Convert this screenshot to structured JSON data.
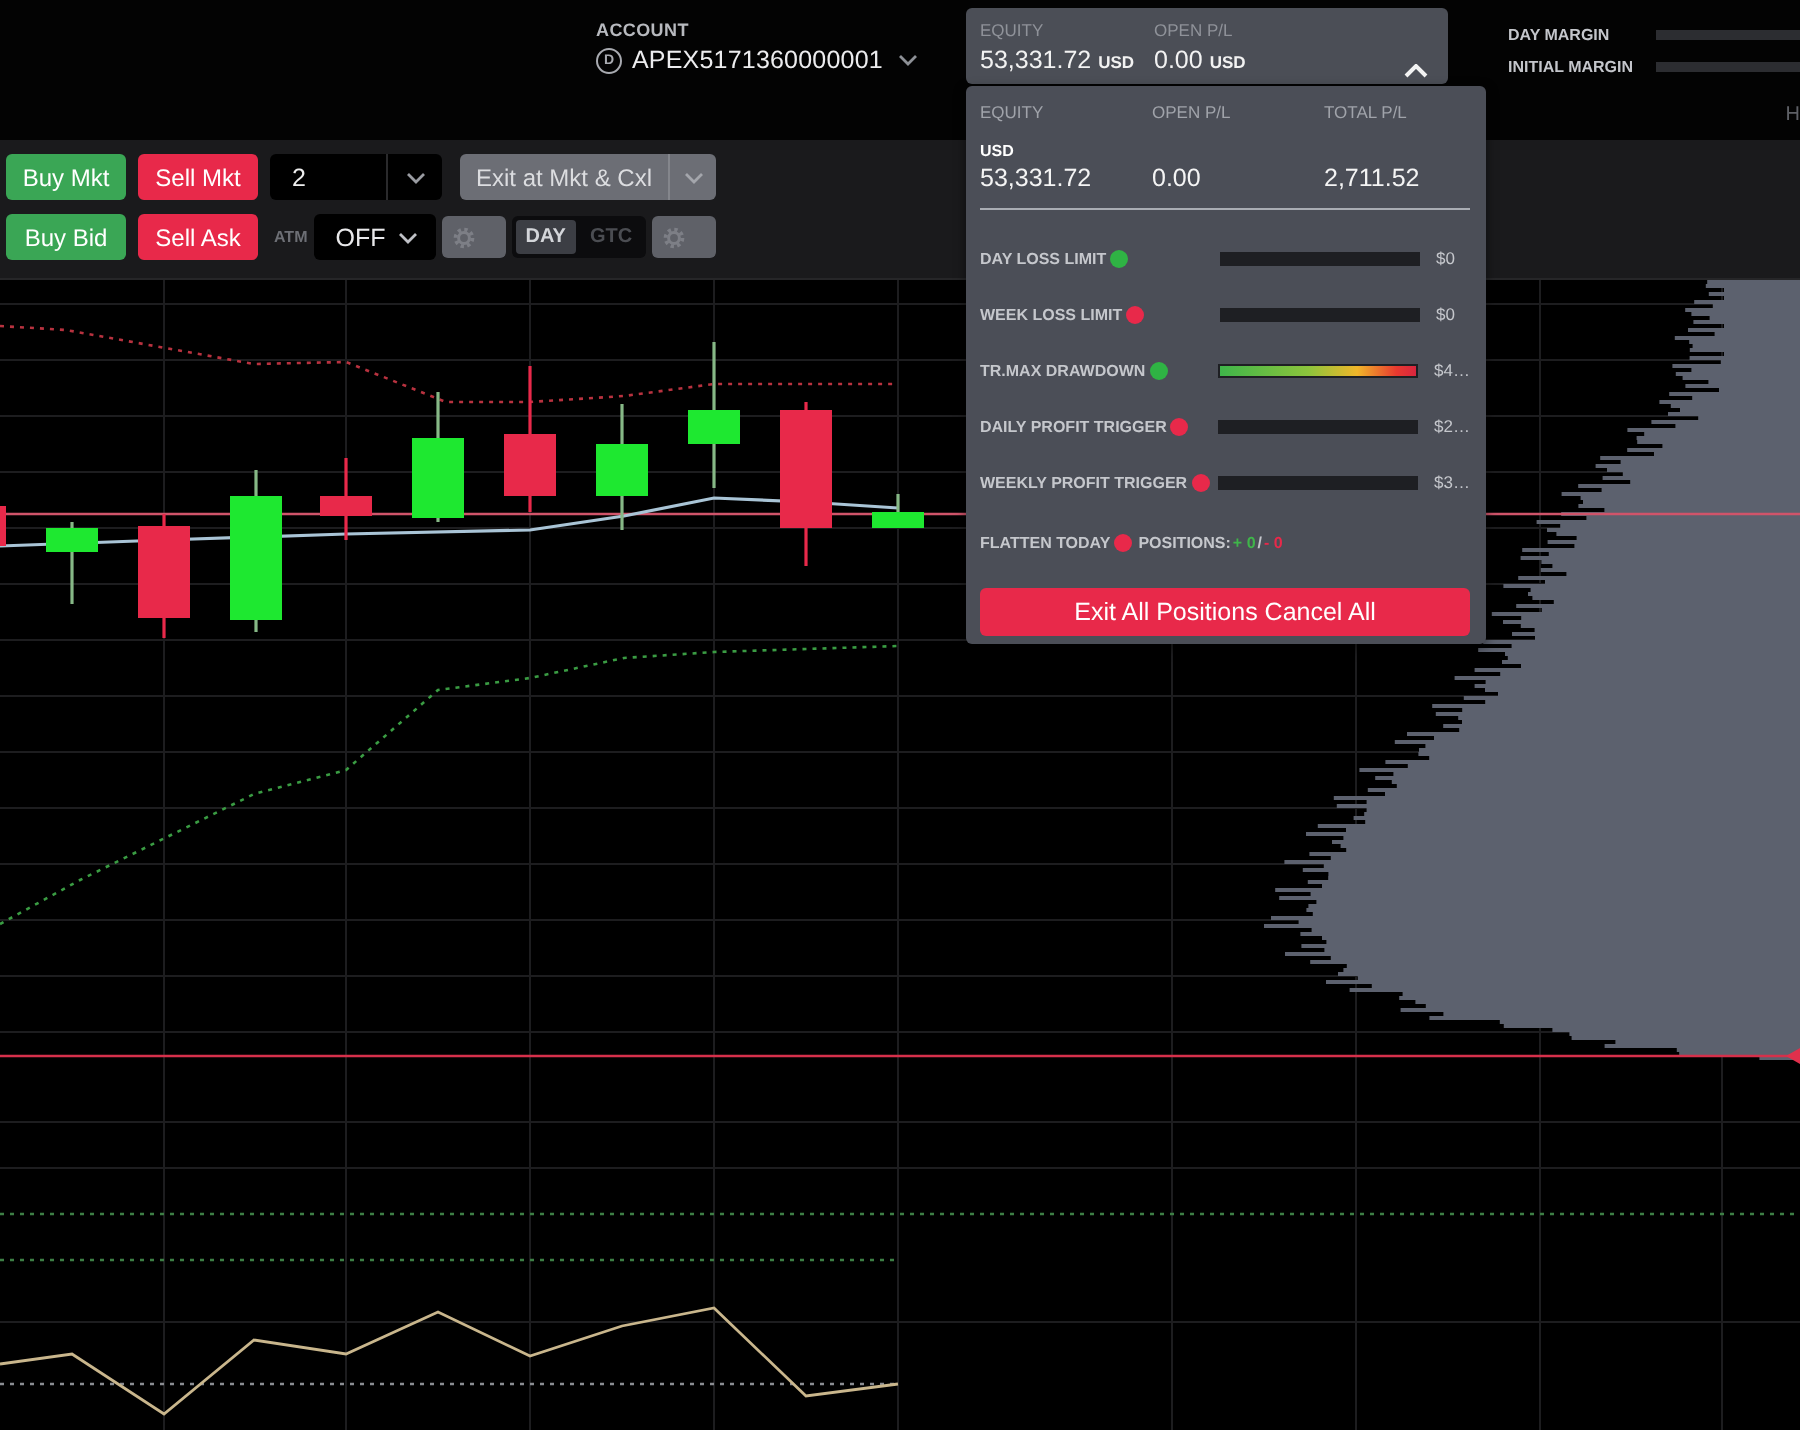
{
  "account": {
    "label": "ACCOUNT",
    "badge": "D",
    "number": "APEX5171360000001"
  },
  "equity_summary": {
    "expanded": true,
    "fields": [
      {
        "label": "EQUITY",
        "value": "53,331.72",
        "unit": "USD"
      },
      {
        "label": "OPEN P/L",
        "value": "0.00",
        "unit": "USD"
      }
    ]
  },
  "margins": [
    {
      "label": "DAY MARGIN"
    },
    {
      "label": "INITIAL MARGIN"
    }
  ],
  "edge_text": "H",
  "toolbar": {
    "rows": [
      [
        {
          "kind": "button",
          "label": "Buy Mkt",
          "color": "#3aa655"
        },
        {
          "kind": "button",
          "label": "Sell Mkt",
          "color": "#e8294a"
        },
        {
          "kind": "quantity",
          "value": "2"
        },
        {
          "kind": "split",
          "label": "Exit at Mkt & Cxl"
        }
      ],
      [
        {
          "kind": "button",
          "label": "Buy Bid",
          "color": "#3aa655"
        },
        {
          "kind": "button",
          "label": "Sell Ask",
          "color": "#e8294a"
        },
        {
          "kind": "select",
          "label": "ATM",
          "value": "OFF"
        },
        {
          "kind": "settings"
        },
        {
          "kind": "toggle",
          "options": [
            {
              "label": "DAY",
              "selected": true
            },
            {
              "label": "GTC",
              "selected": false
            }
          ]
        },
        {
          "kind": "settings"
        }
      ]
    ]
  },
  "account_panel": {
    "columns": [
      {
        "label": "EQUITY",
        "value": "53,331.72"
      },
      {
        "label": "OPEN P/L",
        "value": "0.00"
      },
      {
        "label": "TOTAL P/L",
        "value": "2,711.52"
      }
    ],
    "currency": "USD",
    "limits": [
      {
        "label": "DAY LOSS LIMIT",
        "color": "#2fb344",
        "amount": "$0"
      },
      {
        "label": "WEEK LOSS LIMIT",
        "color": "#e8294a",
        "amount": "$0"
      },
      {
        "label": "TR.MAX DRAWDOWN",
        "color": "#2fb344",
        "level": 1,
        "amount": "$4…"
      },
      {
        "label": "DAILY PROFIT TRIGGER",
        "color": "#e8294a",
        "amount": "$2…"
      },
      {
        "label": "WEEKLY PROFIT TRIGGER",
        "color": "#e8294a",
        "amount": "$3…"
      }
    ],
    "flatten": {
      "label": "FLATTEN TODAY",
      "color": "#e8294a",
      "positions_label": "POSITIONS:",
      "long": "+ 0",
      "separator": "/",
      "short": "- 0"
    },
    "exit_button": "Exit All Positions Cancel All"
  }
}
